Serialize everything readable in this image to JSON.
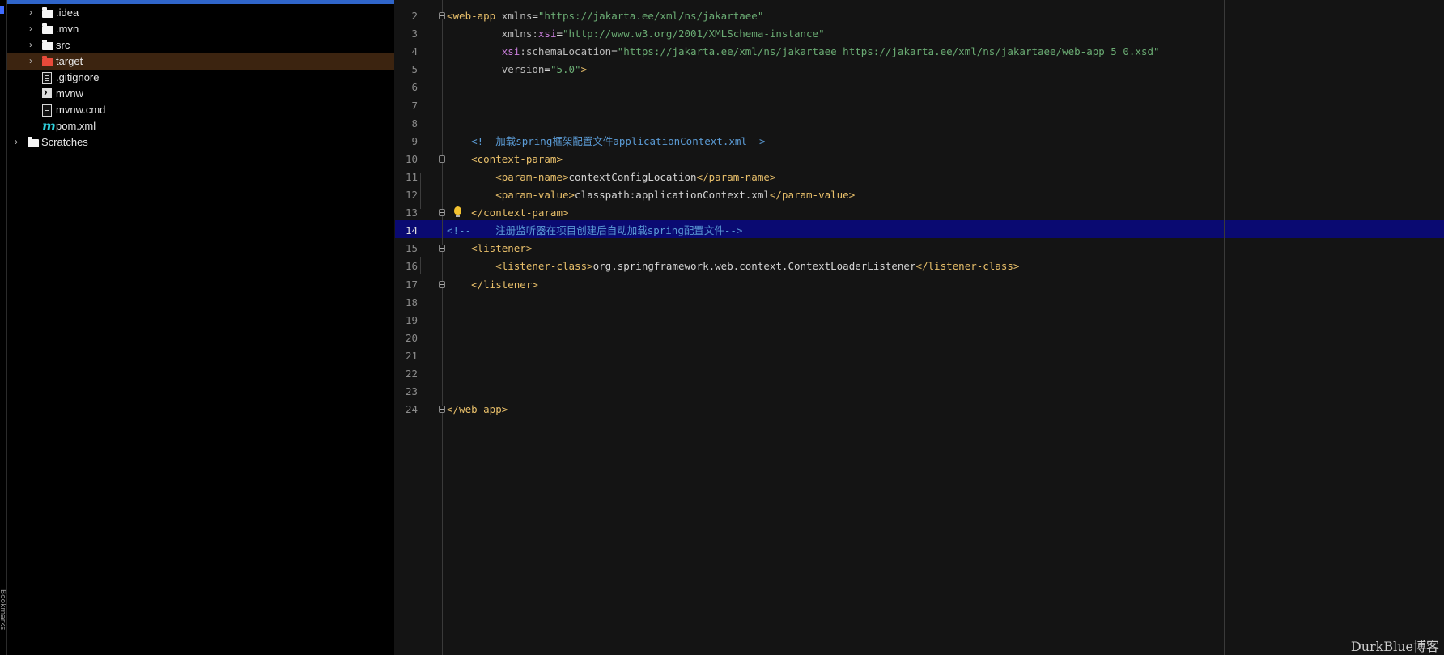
{
  "sidebar": {
    "bookmarks_label": "Bookmarks"
  },
  "project_tree": {
    "items": [
      {
        "label": ".idea",
        "icon": "folder-icon",
        "expandable": true
      },
      {
        "label": ".mvn",
        "icon": "folder-icon",
        "expandable": true
      },
      {
        "label": "src",
        "icon": "folder-icon",
        "expandable": true
      },
      {
        "label": "target",
        "icon": "excluded-folder-icon",
        "expandable": true
      },
      {
        "label": ".gitignore",
        "icon": "gitignore-file-icon",
        "expandable": false
      },
      {
        "label": "mvnw",
        "icon": "shell-script-icon",
        "expandable": false
      },
      {
        "label": "mvnw.cmd",
        "icon": "text-file-icon",
        "expandable": false
      },
      {
        "label": "pom.xml",
        "icon": "maven-icon",
        "expandable": false
      },
      {
        "label": "Scratches",
        "icon": "folder-icon",
        "expandable": true
      }
    ]
  },
  "editor": {
    "current_line": 14,
    "lines": [
      {
        "n": "2",
        "tokens": [
          {
            "t": "<web-app ",
            "c": "tag"
          },
          {
            "t": "xmlns",
            "c": "attr"
          },
          {
            "t": "=",
            "c": "txt"
          },
          {
            "t": "\"https://jakarta.ee/xml/ns/jakartaee\"",
            "c": "val"
          }
        ]
      },
      {
        "n": "3",
        "tokens": [
          {
            "t": "         xmlns:",
            "c": "attr"
          },
          {
            "t": "xsi",
            "c": "ns"
          },
          {
            "t": "=",
            "c": "txt"
          },
          {
            "t": "\"http://www.w3.org/2001/XMLSchema-instance\"",
            "c": "val"
          }
        ]
      },
      {
        "n": "4",
        "tokens": [
          {
            "t": "         ",
            "c": "txt"
          },
          {
            "t": "xsi",
            "c": "ns"
          },
          {
            "t": ":schemaLocation",
            "c": "attr"
          },
          {
            "t": "=",
            "c": "txt"
          },
          {
            "t": "\"https://jakarta.ee/xml/ns/jakartaee https://jakarta.ee/xml/ns/jakartaee/web-app_5_0.xsd\"",
            "c": "val"
          }
        ]
      },
      {
        "n": "5",
        "tokens": [
          {
            "t": "         version",
            "c": "attr"
          },
          {
            "t": "=",
            "c": "txt"
          },
          {
            "t": "\"5.0\"",
            "c": "val"
          },
          {
            "t": ">",
            "c": "tag"
          }
        ]
      },
      {
        "n": "6",
        "tokens": []
      },
      {
        "n": "7",
        "tokens": []
      },
      {
        "n": "8",
        "tokens": []
      },
      {
        "n": "9",
        "tokens": [
          {
            "t": "    <!--加载spring框架配置文件applicationContext.xml-->",
            "c": "cmt"
          }
        ]
      },
      {
        "n": "10",
        "tokens": [
          {
            "t": "    <context-param>",
            "c": "tag"
          }
        ]
      },
      {
        "n": "11",
        "tokens": [
          {
            "t": "        <param-name>",
            "c": "tag"
          },
          {
            "t": "contextConfigLocation",
            "c": "txt"
          },
          {
            "t": "</param-name>",
            "c": "tag"
          }
        ]
      },
      {
        "n": "12",
        "tokens": [
          {
            "t": "        <param-value>",
            "c": "tag"
          },
          {
            "t": "classpath:applicationContext.xml",
            "c": "txt"
          },
          {
            "t": "</param-value>",
            "c": "tag"
          }
        ]
      },
      {
        "n": "13",
        "tokens": [
          {
            "t": "    </context-param>",
            "c": "tag"
          }
        ]
      },
      {
        "n": "14",
        "tokens": [
          {
            "t": "<!--    注册监听器在项目创建后自动加载spring配置文件-->",
            "c": "cmt"
          }
        ]
      },
      {
        "n": "15",
        "tokens": [
          {
            "t": "    <listener>",
            "c": "tag"
          }
        ]
      },
      {
        "n": "16",
        "tokens": [
          {
            "t": "        <listener-class>",
            "c": "tag"
          },
          {
            "t": "org.springframework.web.context.ContextLoaderListener",
            "c": "txt"
          },
          {
            "t": "</listener-class>",
            "c": "tag"
          }
        ]
      },
      {
        "n": "17",
        "tokens": [
          {
            "t": "    </listener>",
            "c": "tag"
          }
        ]
      },
      {
        "n": "18",
        "tokens": []
      },
      {
        "n": "19",
        "tokens": []
      },
      {
        "n": "20",
        "tokens": []
      },
      {
        "n": "21",
        "tokens": []
      },
      {
        "n": "22",
        "tokens": []
      },
      {
        "n": "23",
        "tokens": []
      },
      {
        "n": "24",
        "tokens": [
          {
            "t": "</web-app>",
            "c": "tag"
          }
        ]
      }
    ]
  },
  "watermark": "DurkBlue博客"
}
